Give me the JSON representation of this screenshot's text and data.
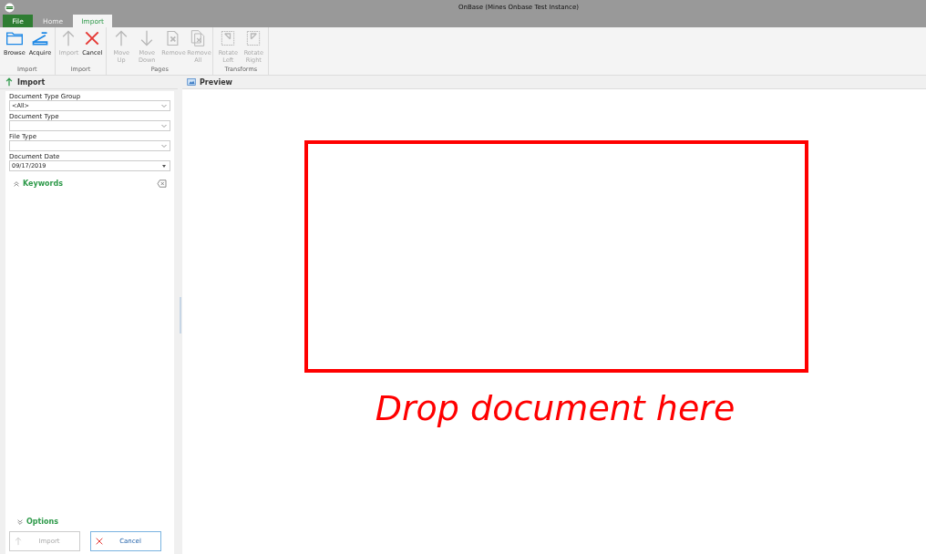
{
  "window": {
    "title": "OnBase (Mines Onbase Test Instance)"
  },
  "tabs": [
    {
      "label": "File",
      "kind": "file",
      "selected": false
    },
    {
      "label": "Home",
      "kind": "tab",
      "selected": false
    },
    {
      "label": "Import",
      "kind": "tab",
      "selected": true
    }
  ],
  "ribbon": [
    {
      "label": "Import",
      "buttons": [
        {
          "label": "Browse",
          "kind": "folder",
          "disabled": false
        },
        {
          "label": "Acquire",
          "kind": "scanner",
          "disabled": false
        }
      ]
    },
    {
      "label": "Import",
      "buttons": [
        {
          "label": "Import",
          "kind": "up",
          "disabled": true
        },
        {
          "label": "Cancel",
          "kind": "cross",
          "disabled": false
        }
      ]
    },
    {
      "label": "Pages",
      "buttons": [
        {
          "label": "Move Up",
          "kind": "up",
          "disabled": true
        },
        {
          "label": "Move Down",
          "kind": "down",
          "disabled": true
        },
        {
          "label": "Remove",
          "kind": "remove",
          "disabled": true
        },
        {
          "label": "Remove All",
          "kind": "removeall",
          "disabled": true
        }
      ]
    },
    {
      "label": "Transforms",
      "buttons": [
        {
          "label": "Rotate Left",
          "kind": "rotleft",
          "disabled": true
        },
        {
          "label": "Rotate Right",
          "kind": "rotright",
          "disabled": true
        }
      ]
    }
  ],
  "import_panel": {
    "title": "Import",
    "fields": [
      {
        "label": "Document Type Group",
        "value": "<All>",
        "kind": "dropdown"
      },
      {
        "label": "Document Type",
        "kind": "dropdown"
      },
      {
        "label": "File Type",
        "kind": "dropdown"
      },
      {
        "label": "Document Date",
        "value": "09/17/2019",
        "kind": "date"
      }
    ],
    "keywords": {
      "label": "Keywords",
      "expanded": true
    },
    "options": {
      "label": "Options",
      "expanded": false
    },
    "buttons": [
      {
        "label": "Import",
        "kind": "up",
        "disabled": true
      },
      {
        "label": "Cancel",
        "kind": "cross",
        "disabled": false
      }
    ]
  },
  "preview": {
    "title": "Preview",
    "drop_hint": "Drop document here"
  }
}
